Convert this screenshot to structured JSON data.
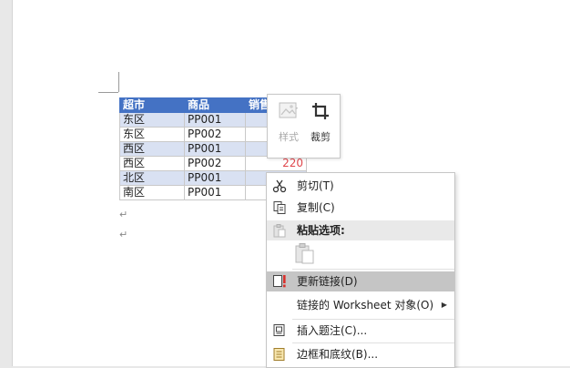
{
  "table": {
    "headers": [
      "超市",
      "商品",
      "销售"
    ],
    "rows": [
      [
        "东区",
        "PP001",
        ""
      ],
      [
        "东区",
        "PP002",
        ""
      ],
      [
        "西区",
        "PP001",
        ""
      ],
      [
        "西区",
        "PP002",
        "220"
      ],
      [
        "北区",
        "PP001",
        ""
      ],
      [
        "南区",
        "PP001",
        ""
      ]
    ]
  },
  "paragraph_mark": "↵",
  "picture_toolbar": {
    "style_label": "样式",
    "crop_label": "裁剪"
  },
  "context_menu": {
    "items": [
      {
        "label": "剪切(T)",
        "icon": "scissors-icon"
      },
      {
        "label": "复制(C)",
        "icon": "copy-icon"
      },
      {
        "label": "粘贴选项:",
        "icon": "paste-icon"
      },
      {
        "label": "更新链接(D)",
        "icon": "update-link-icon"
      },
      {
        "label": "链接的 Worksheet 对象(O)",
        "icon": ""
      },
      {
        "label": "插入题注(C)...",
        "icon": "caption-icon"
      },
      {
        "label": "边框和底纹(B)...",
        "icon": "border-icon"
      }
    ]
  },
  "colors": {
    "header_blue": "#4472c4",
    "band_blue": "#d9e1f2",
    "value_red": "#e0474c",
    "menu_hover": "#c5c5c5"
  }
}
